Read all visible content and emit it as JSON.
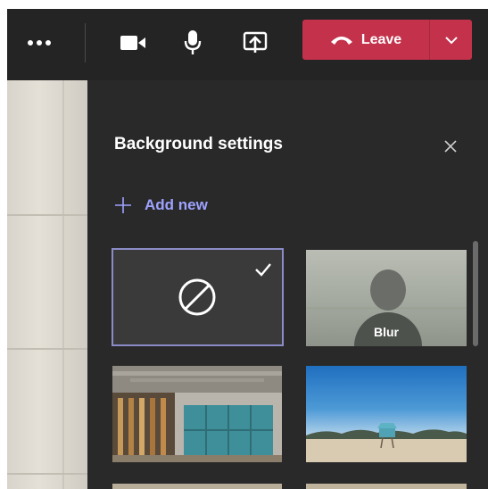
{
  "toolbar": {
    "more_icon": "more-options-icon",
    "camera_icon": "video-camera-icon",
    "mic_icon": "microphone-icon",
    "share_icon": "share-screen-icon",
    "leave_label": "Leave",
    "leave_icon": "hang-up-phone-icon",
    "leave_dropdown_icon": "chevron-down-icon",
    "leave_color": "#c4314b"
  },
  "panel": {
    "title": "Background settings",
    "close_icon": "close-icon",
    "add_new_label": "Add new",
    "add_new_icon": "plus-icon",
    "accent_color": "#9ea2ff",
    "options": [
      {
        "id": "none",
        "icon": "no-background-icon",
        "selected": true,
        "check_icon": "checkmark-icon"
      },
      {
        "id": "blur",
        "label": "Blur"
      },
      {
        "id": "office",
        "image": "office interior with glass wall and blue lockers"
      },
      {
        "id": "beach",
        "image": "beach with lifeguard tower under blue sky"
      }
    ]
  }
}
